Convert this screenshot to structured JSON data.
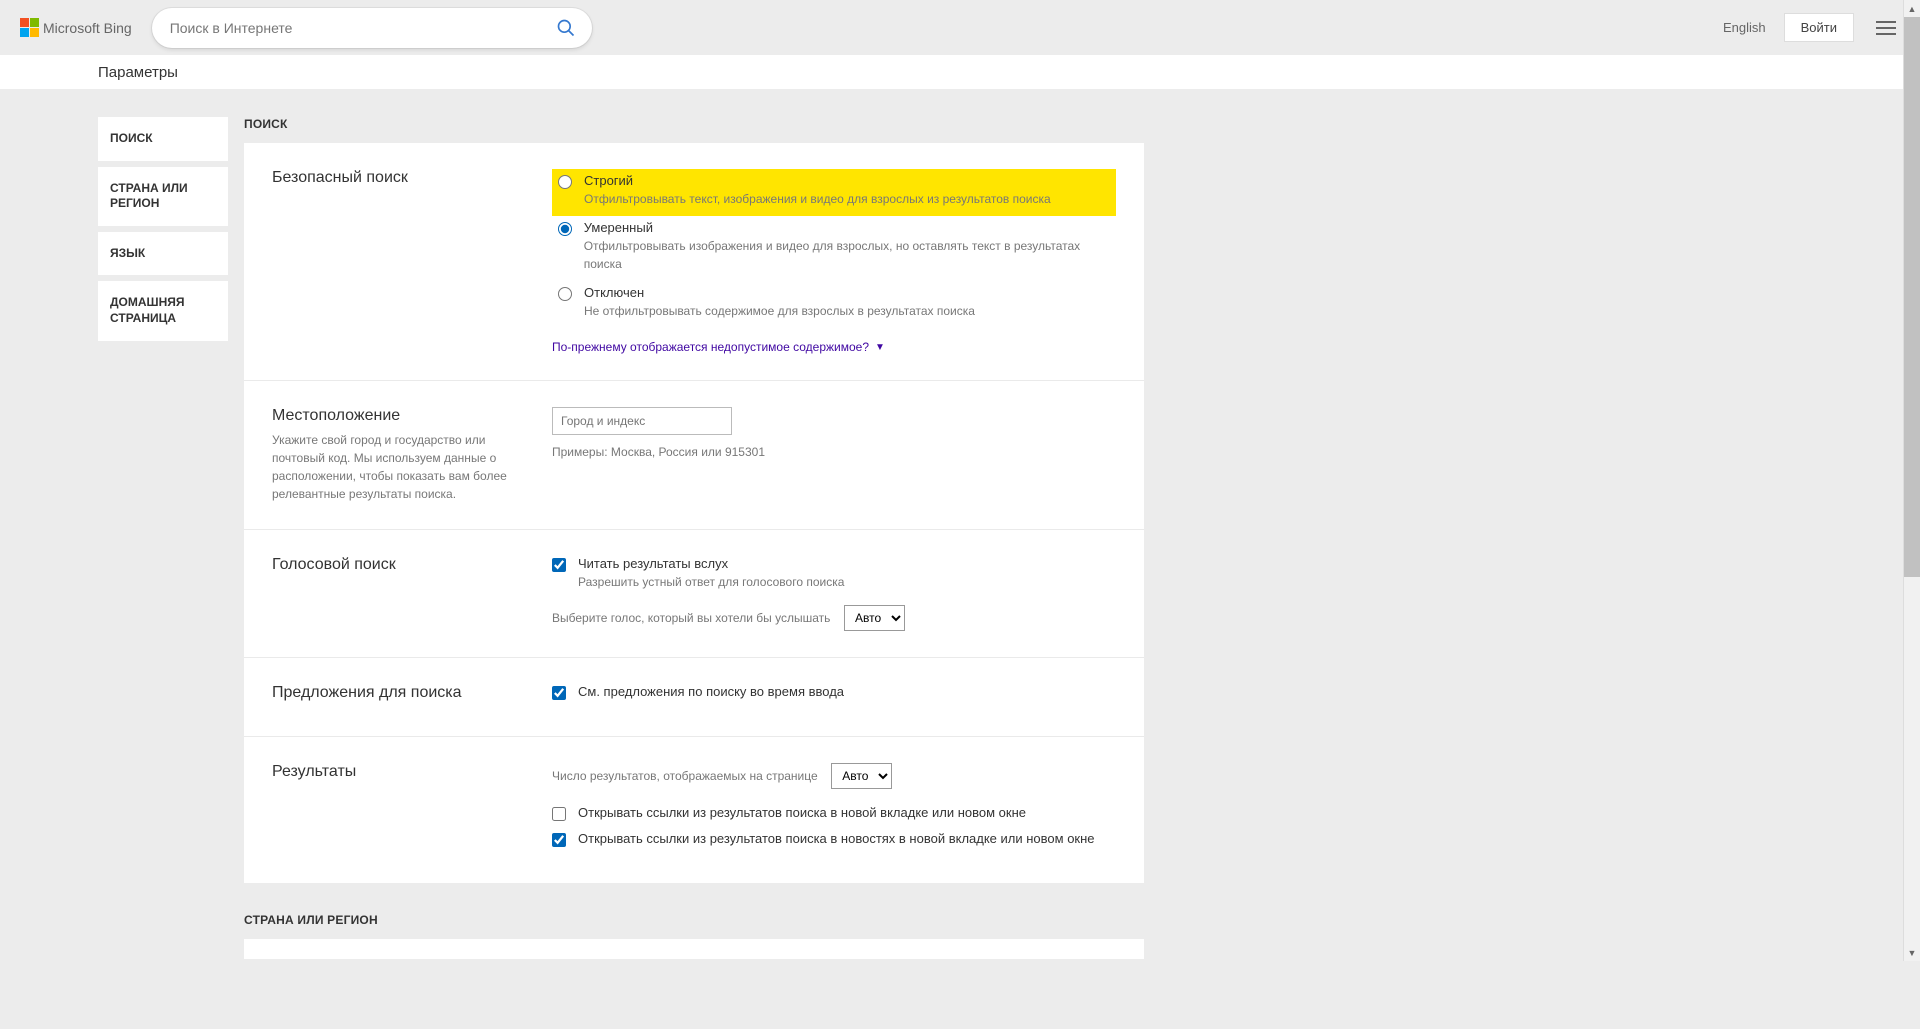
{
  "header": {
    "logo_text": "Microsoft Bing",
    "search_placeholder": "Поиск в Интернете",
    "lang": "English",
    "signin": "Войти"
  },
  "breadcrumb": "Параметры",
  "sidebar": {
    "items": [
      "ПОИСК",
      "СТРАНА ИЛИ РЕГИОН",
      "ЯЗЫК",
      "ДОМАШНЯЯ СТРАНИЦА"
    ]
  },
  "sections": {
    "search_heading": "ПОИСК",
    "region_heading": "СТРАНА ИЛИ РЕГИОН"
  },
  "safesearch": {
    "title": "Безопасный поиск",
    "options": [
      {
        "label": "Строгий",
        "sub": "Отфильтровывать текст, изображения и видео для взрослых из результатов поиска"
      },
      {
        "label": "Умеренный",
        "sub": "Отфильтровывать изображения и видео для взрослых, но оставлять текст в результатах поиска"
      },
      {
        "label": "Отключен",
        "sub": "Не отфильтровывать содержимое для взрослых в результатах поиска"
      }
    ],
    "link": "По-прежнему отображается недопустимое содержимое?"
  },
  "location": {
    "title": "Местоположение",
    "desc": "Укажите свой город и государство или почтовый код. Мы используем данные о расположении, чтобы показать вам более релевантные результаты поиска.",
    "placeholder": "Город и индекс",
    "helper": "Примеры: Москва, Россия или 915301"
  },
  "voice": {
    "title": "Голосовой поиск",
    "check_label": "Читать результаты вслух",
    "check_sub": "Разрешить устный ответ для голосового поиска",
    "select_label": "Выберите голос, который вы хотели бы услышать",
    "select_value": "Авто"
  },
  "suggestions": {
    "title": "Предложения для поиска",
    "check_label": "См. предложения по поиску во время ввода"
  },
  "results": {
    "title": "Результаты",
    "count_label": "Число результатов, отображаемых на странице",
    "count_value": "Авто",
    "open_new_tab": "Открывать ссылки из результатов поиска в новой вкладке или новом окне",
    "open_news_new_tab": "Открывать ссылки из результатов поиска в новостях в новой вкладке или новом окне"
  }
}
